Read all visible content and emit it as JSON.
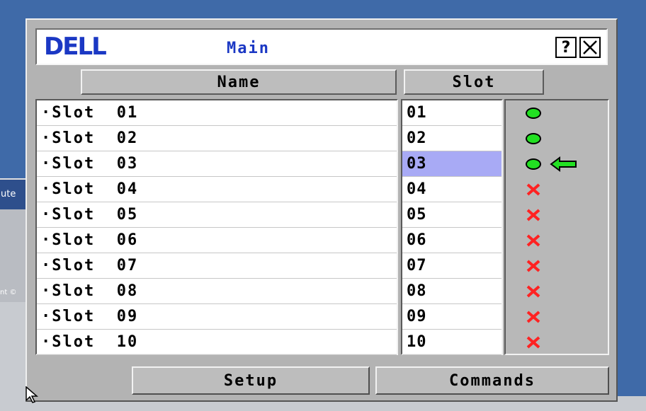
{
  "window": {
    "logo_text": "DELL",
    "title": "Main",
    "help_label": "?",
    "close_label": "✕"
  },
  "headers": {
    "name": "Name",
    "slot": "Slot"
  },
  "rows": [
    {
      "name": "·Slot  01",
      "slot": "01",
      "status": "online",
      "selected": false
    },
    {
      "name": "·Slot  02",
      "slot": "02",
      "status": "online",
      "selected": false
    },
    {
      "name": "·Slot  03",
      "slot": "03",
      "status": "online",
      "selected": true
    },
    {
      "name": "·Slot  04",
      "slot": "04",
      "status": "offline",
      "selected": false
    },
    {
      "name": "·Slot  05",
      "slot": "05",
      "status": "offline",
      "selected": false
    },
    {
      "name": "·Slot  06",
      "slot": "06",
      "status": "offline",
      "selected": false
    },
    {
      "name": "·Slot  07",
      "slot": "07",
      "status": "offline",
      "selected": false
    },
    {
      "name": "·Slot  08",
      "slot": "08",
      "status": "offline",
      "selected": false
    },
    {
      "name": "·Slot  09",
      "slot": "09",
      "status": "offline",
      "selected": false
    },
    {
      "name": "·Slot  10",
      "slot": "10",
      "status": "offline",
      "selected": false
    }
  ],
  "buttons": {
    "setup": "Setup",
    "commands": "Commands"
  },
  "desktop": {
    "left_window_title_fragment": "ute",
    "left_window_footer_fragment": "nt ©"
  },
  "colors": {
    "brand": "#1b38c4",
    "online": "#22e022",
    "offline": "#ff2222",
    "selected": "#a8aaf5",
    "active_arrow": "#22e022"
  },
  "icons": {
    "online": "green-circle-icon",
    "offline": "red-x-icon",
    "active": "left-arrow-icon"
  }
}
